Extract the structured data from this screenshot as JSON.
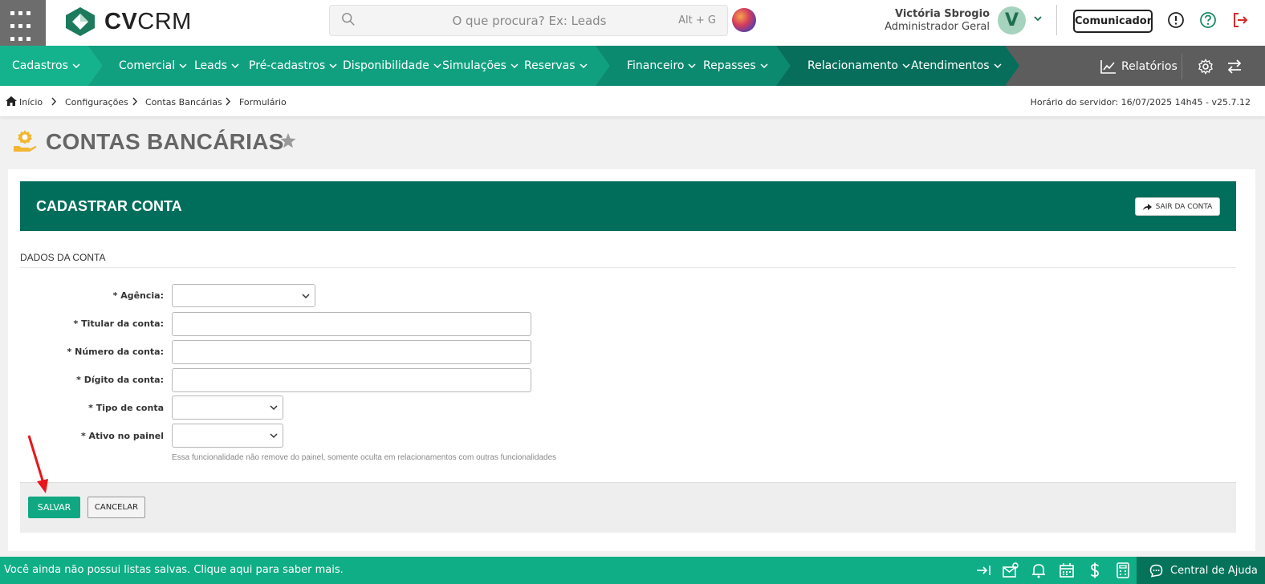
{
  "brand": {
    "name_bold": "CV",
    "name_light": "CRM"
  },
  "search": {
    "placeholder": "O que procura? Ex: Leads",
    "shortcut": "Alt + G"
  },
  "user": {
    "name": "Victória Sbrogio",
    "role": "Administrador Geral",
    "initial": "V"
  },
  "top_actions": {
    "communicator": "Comunicador"
  },
  "nav": {
    "items": [
      "Cadastros",
      "Comercial",
      "Leads",
      "Pré-cadastros",
      "Disponibilidade",
      "Simulações",
      "Reservas",
      "Financeiro",
      "Repasses",
      "Relacionamento",
      "Atendimentos"
    ],
    "reports": "Relatórios",
    "colors": {
      "seg1": "#15b38d",
      "seg2": "#10a080",
      "seg3": "#0b8a70",
      "seg4": "#076e5b",
      "base": "#5d5d5d"
    }
  },
  "breadcrumb": {
    "items": [
      "Início",
      "Configurações",
      "Contas Bancárias",
      "Formulário"
    ],
    "server_time": "Horário do servidor: 16/07/2025 14h45 - v25.7.12"
  },
  "page": {
    "title": "CONTAS BANCÁRIAS"
  },
  "card": {
    "title": "CADASTRAR CONTA",
    "exit_label": "SAIR DA CONTA"
  },
  "form": {
    "section": "DADOS DA CONTA",
    "fields": {
      "agencia": {
        "label": "* Agência:",
        "value": ""
      },
      "titular": {
        "label": "* Titular da conta:",
        "value": ""
      },
      "numero": {
        "label": "* Número da conta:",
        "value": ""
      },
      "digito": {
        "label": "* Dígito da conta:",
        "value": ""
      },
      "tipo": {
        "label": "* Tipo de conta",
        "value": ""
      },
      "ativo": {
        "label": "* Ativo no painel",
        "value": ""
      }
    },
    "help": "Essa funcionalidade não remove do painel, somente oculta em relacionamentos com outras funcionalidades",
    "save": "SALVAR",
    "cancel": "CANCELAR"
  },
  "bottom": {
    "message": "Você ainda não possui listas salvas. Clique aqui para saber mais.",
    "help_center": "Central de Ajuda"
  }
}
